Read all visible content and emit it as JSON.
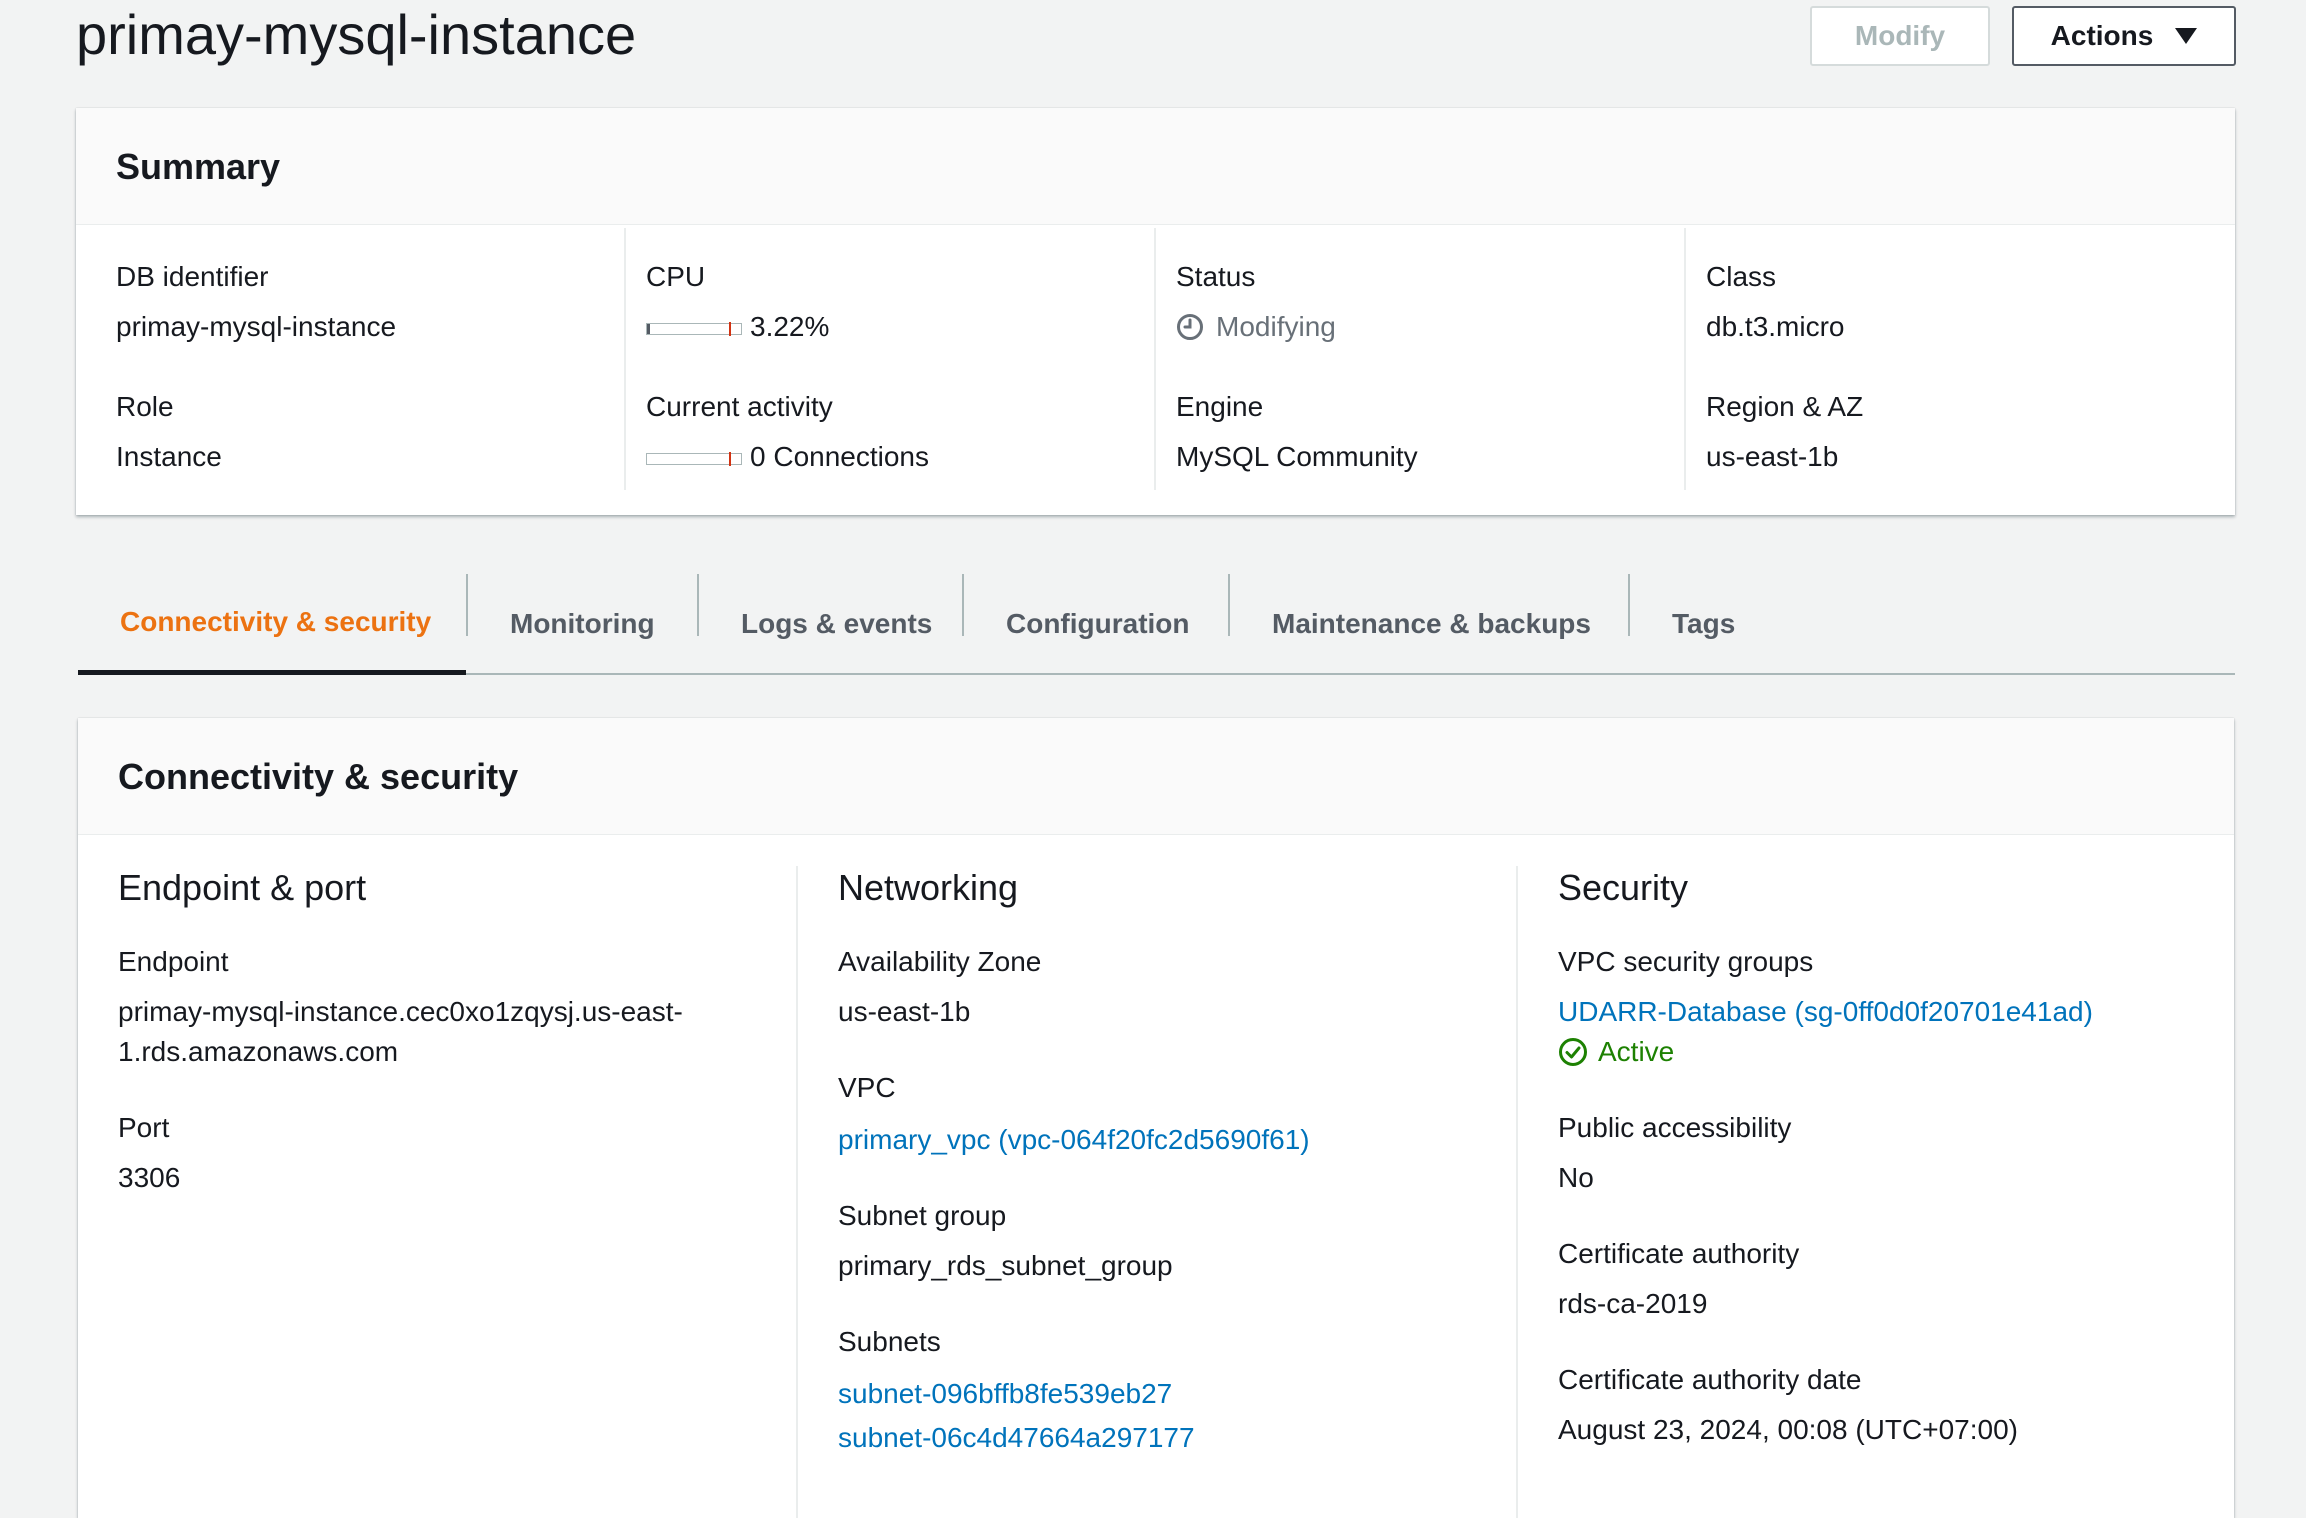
{
  "page": {
    "title": "primay-mysql-instance"
  },
  "header": {
    "modify_label": "Modify",
    "actions_label": "Actions"
  },
  "summary": {
    "title": "Summary",
    "db_identifier": {
      "label": "DB identifier",
      "value": "primay-mysql-instance"
    },
    "role": {
      "label": "Role",
      "value": "Instance"
    },
    "cpu": {
      "label": "CPU",
      "value": "3.22%",
      "level": 0.0322
    },
    "current_activity": {
      "label": "Current activity",
      "value": "0 Connections",
      "level": 0
    },
    "status": {
      "label": "Status",
      "value": "Modifying",
      "icon": "clock-icon"
    },
    "engine": {
      "label": "Engine",
      "value": "MySQL Community"
    },
    "class": {
      "label": "Class",
      "value": "db.t3.micro"
    },
    "region_az": {
      "label": "Region & AZ",
      "value": "us-east-1b"
    }
  },
  "tabs": [
    {
      "label": "Connectivity & security",
      "active": true
    },
    {
      "label": "Monitoring"
    },
    {
      "label": "Logs & events"
    },
    {
      "label": "Configuration"
    },
    {
      "label": "Maintenance & backups"
    },
    {
      "label": "Tags"
    }
  ],
  "connectivity": {
    "title": "Connectivity & security",
    "endpoint_port": {
      "heading": "Endpoint & port",
      "endpoint_label": "Endpoint",
      "endpoint_line1": "primay-mysql-instance.cec0xo1zqysj.us-east-",
      "endpoint_line2": "1.rds.amazonaws.com",
      "port_label": "Port",
      "port_value": "3306"
    },
    "networking": {
      "heading": "Networking",
      "az_label": "Availability Zone",
      "az_value": "us-east-1b",
      "vpc_label": "VPC",
      "vpc_value": "primary_vpc (vpc-064f20fc2d5690f61)",
      "subnet_group_label": "Subnet group",
      "subnet_group_value": "primary_rds_subnet_group",
      "subnets_label": "Subnets",
      "subnets": [
        "subnet-096bffb8fe539eb27",
        "subnet-06c4d47664a297177"
      ]
    },
    "security": {
      "heading": "Security",
      "sg_label": "VPC security groups",
      "sg_value": "UDARR-Database (sg-0ff0d0f20701e41ad)",
      "sg_status": "Active",
      "public_label": "Public accessibility",
      "public_value": "No",
      "ca_label": "Certificate authority",
      "ca_value": "rds-ca-2019",
      "ca_date_label": "Certificate authority date",
      "ca_date_value": "August 23, 2024, 00:08 (UTC+07:00)"
    }
  },
  "colors": {
    "link": "#0073bb",
    "active_tab": "#ec7211",
    "success": "#1d8102",
    "muted": "#687078"
  }
}
